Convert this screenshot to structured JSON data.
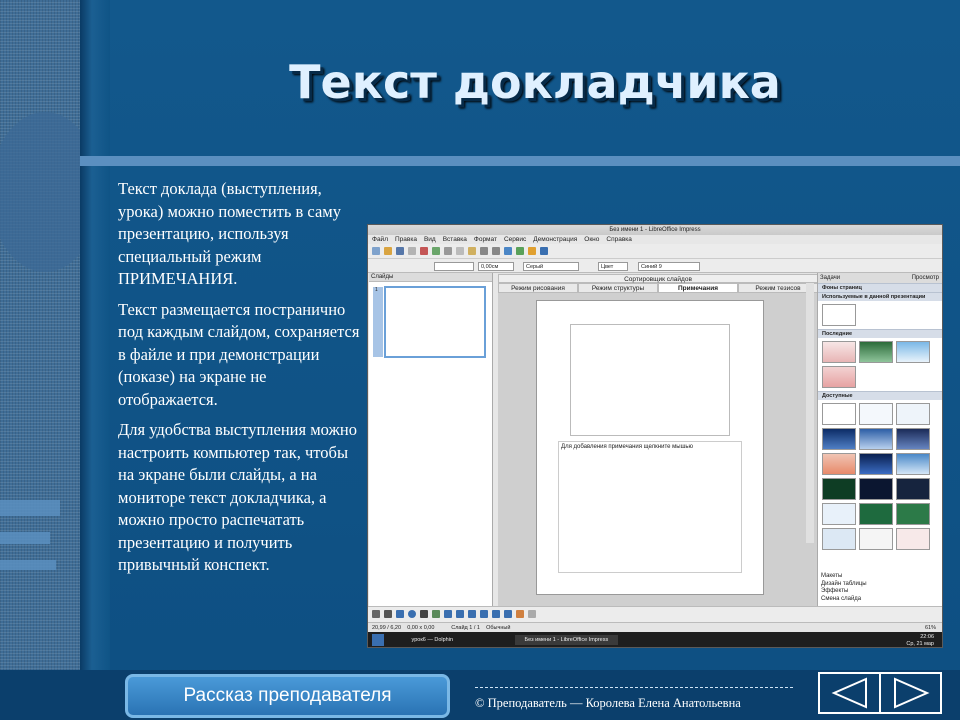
{
  "slide": {
    "title": "Текст докладчика",
    "paragraphs": [
      "Текст доклада (выступления, урока) можно поместить в саму презентацию, используя специальный режим ПРИМЕЧАНИЯ.",
      "Текст размещается постранично под каждым слайдом, сохраняется в файле и при демонстрации (показе) на экране не отображается.",
      "Для удобства выступления можно настроить компьютер так, чтобы на экране были слайды, а на мониторе текст докладчика, а можно просто распечатать презентацию и получить привычный конспект."
    ],
    "nav_button_label": "Рассказ преподавателя",
    "footer_dashes": "--------------------------------------------------------------------",
    "footer_credit": "© Преподаватель — Королева Елена Анатольевна"
  },
  "screenshot": {
    "window_title": "Без имени 1 - LibreOffice Impress",
    "menu": [
      "Файл",
      "Правка",
      "Вид",
      "Вставка",
      "Формат",
      "Сервис",
      "Демонстрация",
      "Окно",
      "Справка"
    ],
    "line_width": "0,00см",
    "area_style": "Серый",
    "color_label": "Цвет",
    "color_value": "Синий 9",
    "slides_panel_title": "Слайды",
    "slide_number": "1",
    "sorter_tab": "Сортировщик слайдов",
    "tabs": [
      "Режим рисования",
      "Режим структуры",
      "Примечания",
      "Режим тезисов"
    ],
    "notes_placeholder": "Для добавления примечания щелкните мышью",
    "tasks_title": "Задачи",
    "tasks_view": "Просмотр",
    "master_pages": "Фоны страниц",
    "used_in_presentation": "Используемые в данной презентации",
    "recent": "Последние",
    "available": "Доступные",
    "other_sections": [
      "Макеты",
      "Дизайн таблицы",
      "Эффекты",
      "Смена слайда"
    ],
    "status_position": "20,99 / 6,20",
    "status_size": "0,00 x 0,00",
    "status_slide": "Слайд 1 / 1",
    "status_layout": "Обычный",
    "status_zoom": "61%",
    "taskbar_items": [
      "урок6 — Dolphin",
      "Без имени 1 - LibreOffice Impress"
    ],
    "clock_time": "22:06",
    "clock_date": "Ср, 21 мар"
  },
  "colors": {
    "background": "#0f5486",
    "band": "#5b8fc0",
    "title": "#dff0ff"
  }
}
